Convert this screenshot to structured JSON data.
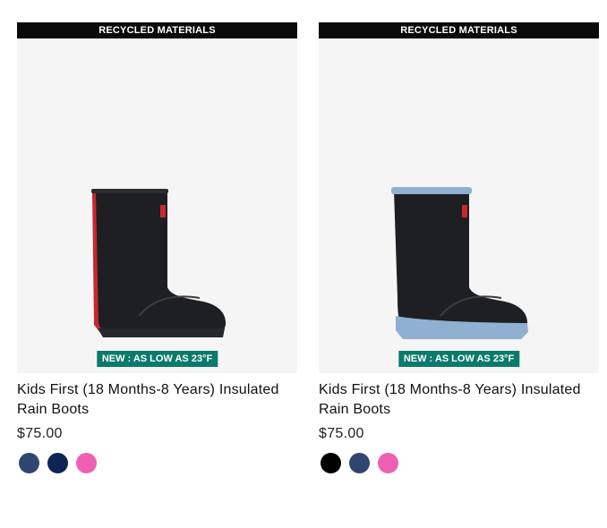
{
  "products": [
    {
      "banner": "RECYCLED MATERIALS",
      "badge": "NEW : AS LOW AS 23°F",
      "title": "Kids First (18 Months-8 Years) Insulated Rain Boots",
      "price": "$75.00",
      "image": {
        "boot_color": "#1d1f22",
        "accent_color": "#c8282d",
        "sole_color": "#1d1f22"
      },
      "swatches": [
        "#2f4670",
        "#0d2457",
        "#ef5fb2"
      ]
    },
    {
      "banner": "RECYCLED MATERIALS",
      "badge": "NEW : AS LOW AS 23°F",
      "title": "Kids First (18 Months-8 Years) Insulated Rain Boots",
      "price": "$75.00",
      "image": {
        "boot_color": "#1d1f22",
        "accent_color": "#8fb0d0",
        "sole_color": "#8fb0d0"
      },
      "swatches": [
        "#000000",
        "#2f4670",
        "#ef5fb2"
      ]
    }
  ]
}
